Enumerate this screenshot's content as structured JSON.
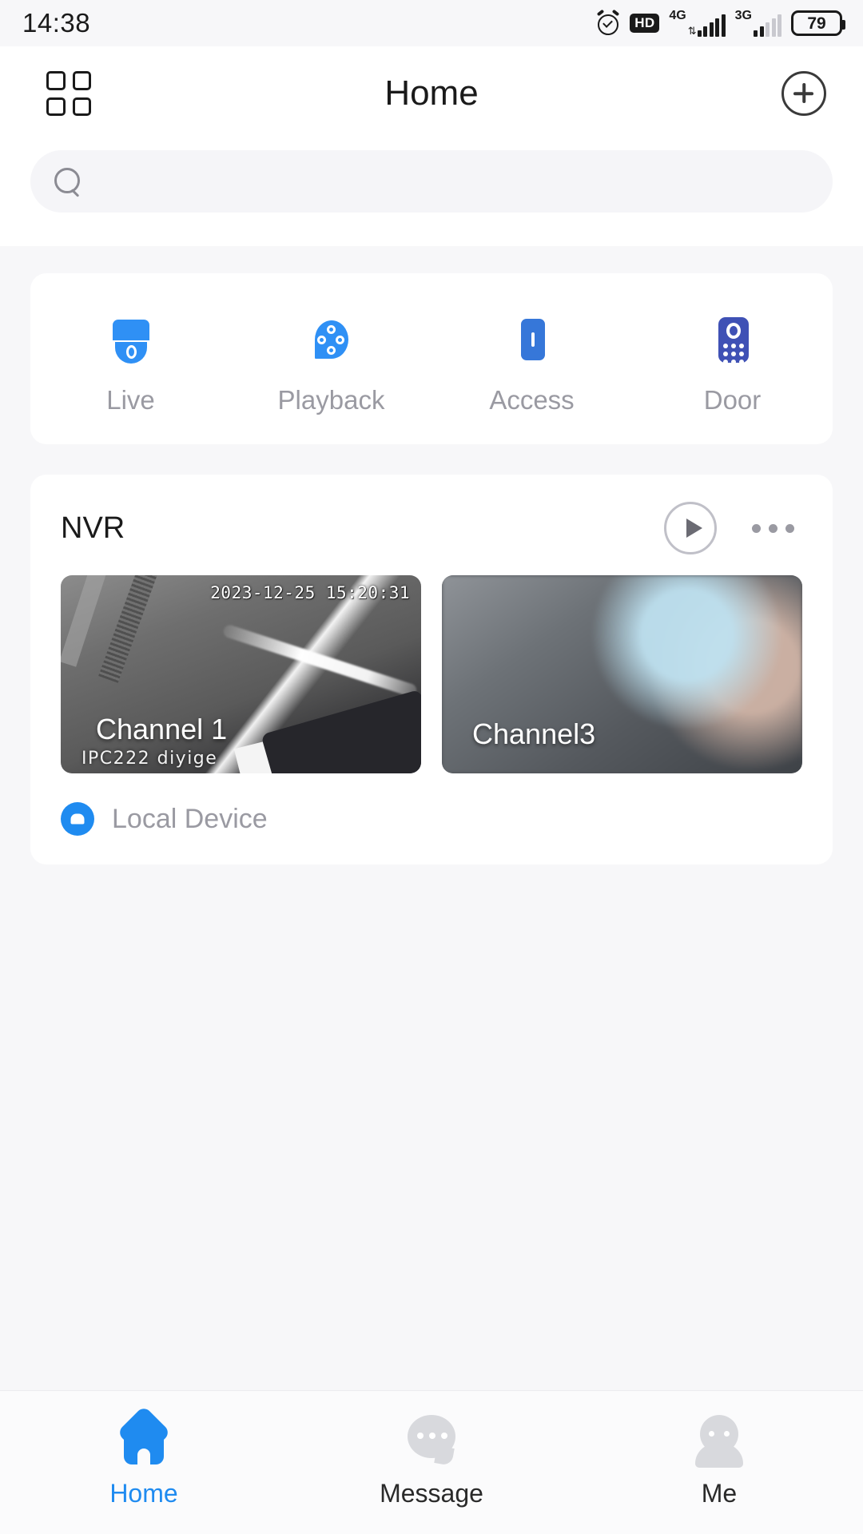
{
  "statusbar": {
    "time": "14:38",
    "alarm_icon": "alarm-clock-icon",
    "hd_label": "HD",
    "sim1_network": "4G",
    "sim2_network": "3G",
    "data_arrows": "⇅",
    "battery_level": "79"
  },
  "header": {
    "grid_icon": "grid-menu-icon",
    "title": "Home",
    "add_icon": "plus-circle-icon"
  },
  "search": {
    "icon": "search-icon",
    "value": "",
    "placeholder": ""
  },
  "quick_actions": {
    "items": [
      {
        "label": "Live",
        "icon": "dome-camera-icon",
        "color": "#2f90f5"
      },
      {
        "label": "Playback",
        "icon": "film-reel-icon",
        "color": "#2f90f5"
      },
      {
        "label": "Access",
        "icon": "access-card-icon",
        "color": "#3677d9"
      },
      {
        "label": "Door",
        "icon": "intercom-icon",
        "color": "#3f51b5"
      }
    ]
  },
  "device_card": {
    "title": "NVR",
    "play_icon": "play-circle-icon",
    "more_icon": "more-dots-icon",
    "channels": [
      {
        "name": "Channel 1",
        "timestamp": "2023-12-25 15:20:31",
        "sub_label": "IPC222 diyige"
      },
      {
        "name": "Channel3",
        "timestamp": "",
        "sub_label": ""
      }
    ],
    "footer": {
      "icon": "local-device-icon",
      "label": "Local Device",
      "icon_color": "#1f8bf0"
    }
  },
  "bottom_nav": {
    "active_color": "#1f8bf0",
    "items": [
      {
        "label": "Home",
        "icon": "home-icon",
        "active": true
      },
      {
        "label": "Message",
        "icon": "message-bubble-icon",
        "active": false
      },
      {
        "label": "Me",
        "icon": "profile-icon",
        "active": false
      }
    ]
  }
}
